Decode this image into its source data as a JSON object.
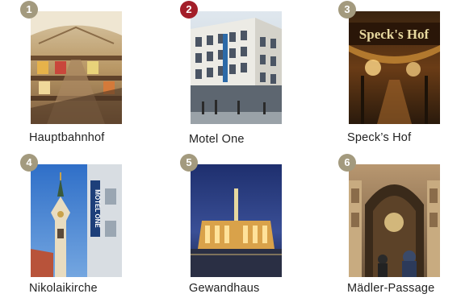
{
  "colors": {
    "badge_default": "#a39a7e",
    "badge_active": "#a31e29"
  },
  "cards": [
    {
      "number": "1",
      "label": "Hauptbahnhof",
      "active": false,
      "icon": "train-station-photo"
    },
    {
      "number": "2",
      "label": "Motel One",
      "active": true,
      "icon": "hotel-photo"
    },
    {
      "number": "3",
      "label": "Speck’s Hof",
      "active": false,
      "icon": "arcade-sign-photo"
    },
    {
      "number": "4",
      "label": "Nikolaikirche",
      "active": false,
      "icon": "church-tower-photo"
    },
    {
      "number": "5",
      "label": "Gewandhaus",
      "active": false,
      "icon": "concert-hall-photo"
    },
    {
      "number": "6",
      "label": "Mädler-Passage",
      "active": false,
      "icon": "passage-photo"
    }
  ],
  "photo_text": {
    "specks_sign": "Speck's Hof",
    "motel_sign": "MOTEL ONE"
  }
}
